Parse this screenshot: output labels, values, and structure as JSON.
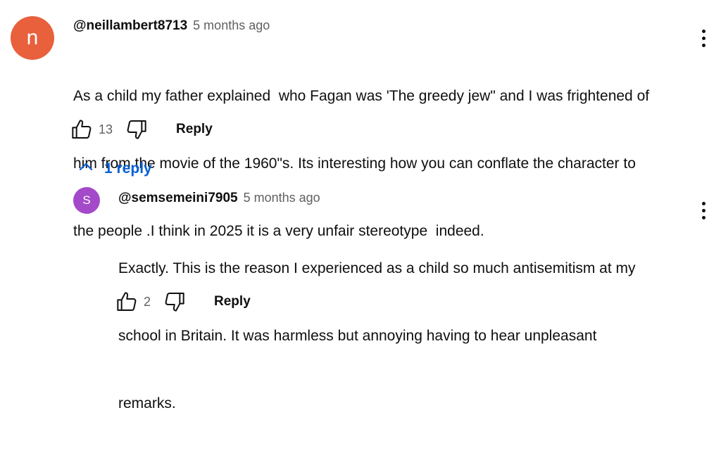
{
  "comments": [
    {
      "avatar_letter": "n",
      "avatar_color": "#e8603c",
      "author": "@neillambert8713",
      "time": "5 months ago",
      "lines": [
        "As a child my father explained  who Fagan was 'The greedy jew\" and I was frightened of",
        "him from the movie of the 1960\"s. Its interesting how you can conflate the character to",
        "the people .I think in 2025 it is a very unfair stereotype  indeed."
      ],
      "likes": "13",
      "reply_label": "Reply",
      "like_icon": "thumbs-up-icon",
      "dislike_icon": "thumbs-down-icon",
      "more_icon": "more-vert-icon"
    }
  ],
  "replies_toggle": {
    "label": "1 reply",
    "icon": "chevron-up-icon",
    "color": "#065fd4"
  },
  "replies": [
    {
      "avatar_letter": "S",
      "avatar_color": "#a349c9",
      "author": "@semsemeini7905",
      "time": "5 months ago",
      "lines": [
        "Exactly. This is the reason I experienced as a child so much antisemitism at my",
        "school in Britain. It was harmless but annoying having to hear unpleasant",
        "remarks."
      ],
      "likes": "2",
      "reply_label": "Reply",
      "like_icon": "thumbs-up-icon",
      "dislike_icon": "thumbs-down-icon",
      "more_icon": "more-vert-icon"
    }
  ]
}
